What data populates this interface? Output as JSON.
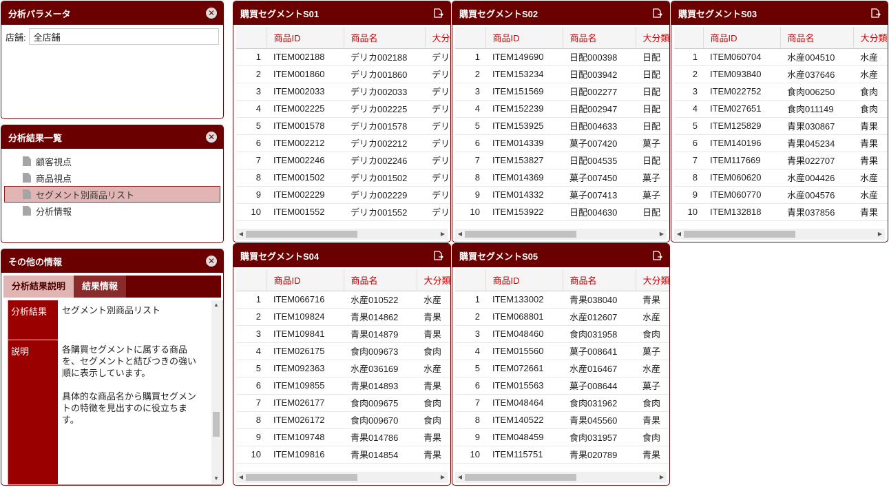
{
  "params_panel": {
    "title": "分析パラメータ",
    "store_label": "店舗:",
    "store_value": "全店舗"
  },
  "results_panel": {
    "title": "分析結果一覧",
    "items": [
      {
        "label": "顧客視点"
      },
      {
        "label": "商品視点"
      },
      {
        "label": "セグメント別商品リスト",
        "selected": true
      },
      {
        "label": "分析情報"
      }
    ]
  },
  "other_panel": {
    "title": "その他の情報",
    "tabs": [
      {
        "label": "分析結果説明",
        "active": true
      },
      {
        "label": "結果情報"
      }
    ],
    "rows": [
      {
        "key": "分析結果",
        "value": "セグメント別商品リスト"
      },
      {
        "key": "説明",
        "value": "各購買セグメントに属する商品\nを、セグメントと結びつきの強い\n順に表示しています。\n\n具体的な商品名から購買セグメン\nトの特徴を見出すのに役立ちま\nす。"
      }
    ]
  },
  "segments": [
    {
      "title": "購買セグメントS01",
      "columns": [
        "",
        "商品ID",
        "商品名",
        "大分類"
      ],
      "rows": [
        [
          "1",
          "ITEM002188",
          "デリカ002188",
          "デリカ"
        ],
        [
          "2",
          "ITEM001860",
          "デリカ001860",
          "デリカ"
        ],
        [
          "3",
          "ITEM002033",
          "デリカ002033",
          "デリカ"
        ],
        [
          "4",
          "ITEM002225",
          "デリカ002225",
          "デリカ"
        ],
        [
          "5",
          "ITEM001578",
          "デリカ001578",
          "デリカ"
        ],
        [
          "6",
          "ITEM002212",
          "デリカ002212",
          "デリカ"
        ],
        [
          "7",
          "ITEM002246",
          "デリカ002246",
          "デリカ"
        ],
        [
          "8",
          "ITEM001502",
          "デリカ001502",
          "デリカ"
        ],
        [
          "9",
          "ITEM002229",
          "デリカ002229",
          "デリカ"
        ],
        [
          "10",
          "ITEM001552",
          "デリカ001552",
          "デリカ"
        ]
      ]
    },
    {
      "title": "購買セグメントS02",
      "columns": [
        "",
        "商品ID",
        "商品名",
        "大分類"
      ],
      "rows": [
        [
          "1",
          "ITEM149690",
          "日配000398",
          "日配"
        ],
        [
          "2",
          "ITEM153234",
          "日配003942",
          "日配"
        ],
        [
          "3",
          "ITEM151569",
          "日配002277",
          "日配"
        ],
        [
          "4",
          "ITEM152239",
          "日配002947",
          "日配"
        ],
        [
          "5",
          "ITEM153925",
          "日配004633",
          "日配"
        ],
        [
          "6",
          "ITEM014339",
          "菓子007420",
          "菓子"
        ],
        [
          "7",
          "ITEM153827",
          "日配004535",
          "日配"
        ],
        [
          "8",
          "ITEM014369",
          "菓子007450",
          "菓子"
        ],
        [
          "9",
          "ITEM014332",
          "菓子007413",
          "菓子"
        ],
        [
          "10",
          "ITEM153922",
          "日配004630",
          "日配"
        ]
      ]
    },
    {
      "title": "購買セグメントS03",
      "columns": [
        "",
        "商品ID",
        "商品名",
        "大分類"
      ],
      "rows": [
        [
          "1",
          "ITEM060704",
          "水産004510",
          "水産"
        ],
        [
          "2",
          "ITEM093840",
          "水産037646",
          "水産"
        ],
        [
          "3",
          "ITEM022752",
          "食肉006250",
          "食肉"
        ],
        [
          "4",
          "ITEM027651",
          "食肉011149",
          "食肉"
        ],
        [
          "5",
          "ITEM125829",
          "青果030867",
          "青果"
        ],
        [
          "6",
          "ITEM140196",
          "青果045234",
          "青果"
        ],
        [
          "7",
          "ITEM117669",
          "青果022707",
          "青果"
        ],
        [
          "8",
          "ITEM060620",
          "水産004426",
          "水産"
        ],
        [
          "9",
          "ITEM060770",
          "水産004576",
          "水産"
        ],
        [
          "10",
          "ITEM132818",
          "青果037856",
          "青果"
        ]
      ]
    },
    {
      "title": "購買セグメントS04",
      "columns": [
        "",
        "商品ID",
        "商品名",
        "大分類"
      ],
      "rows": [
        [
          "1",
          "ITEM066716",
          "水産010522",
          "水産"
        ],
        [
          "2",
          "ITEM109824",
          "青果014862",
          "青果"
        ],
        [
          "3",
          "ITEM109841",
          "青果014879",
          "青果"
        ],
        [
          "4",
          "ITEM026175",
          "食肉009673",
          "食肉"
        ],
        [
          "5",
          "ITEM092363",
          "水産036169",
          "水産"
        ],
        [
          "6",
          "ITEM109855",
          "青果014893",
          "青果"
        ],
        [
          "7",
          "ITEM026177",
          "食肉009675",
          "食肉"
        ],
        [
          "8",
          "ITEM026172",
          "食肉009670",
          "食肉"
        ],
        [
          "9",
          "ITEM109748",
          "青果014786",
          "青果"
        ],
        [
          "10",
          "ITEM109816",
          "青果014854",
          "青果"
        ]
      ]
    },
    {
      "title": "購買セグメントS05",
      "columns": [
        "",
        "商品ID",
        "商品名",
        "大分類"
      ],
      "rows": [
        [
          "1",
          "ITEM133002",
          "青果038040",
          "青果"
        ],
        [
          "2",
          "ITEM068801",
          "水産012607",
          "水産"
        ],
        [
          "3",
          "ITEM048460",
          "食肉031958",
          "食肉"
        ],
        [
          "4",
          "ITEM015560",
          "菓子008641",
          "菓子"
        ],
        [
          "5",
          "ITEM072661",
          "水産016467",
          "水産"
        ],
        [
          "6",
          "ITEM015563",
          "菓子008644",
          "菓子"
        ],
        [
          "7",
          "ITEM048464",
          "食肉031962",
          "食肉"
        ],
        [
          "8",
          "ITEM140522",
          "青果045560",
          "青果"
        ],
        [
          "9",
          "ITEM048459",
          "食肉031957",
          "食肉"
        ],
        [
          "10",
          "ITEM115751",
          "青果020789",
          "青果"
        ]
      ]
    }
  ],
  "colors": {
    "header": "#6b0000",
    "selected_item": "#e2b5b5",
    "column_header_text": "#cc0000",
    "info_key_bg": "#9a0000"
  },
  "icons": {
    "close": "close-icon",
    "export": "export-icon",
    "document": "document-icon"
  }
}
